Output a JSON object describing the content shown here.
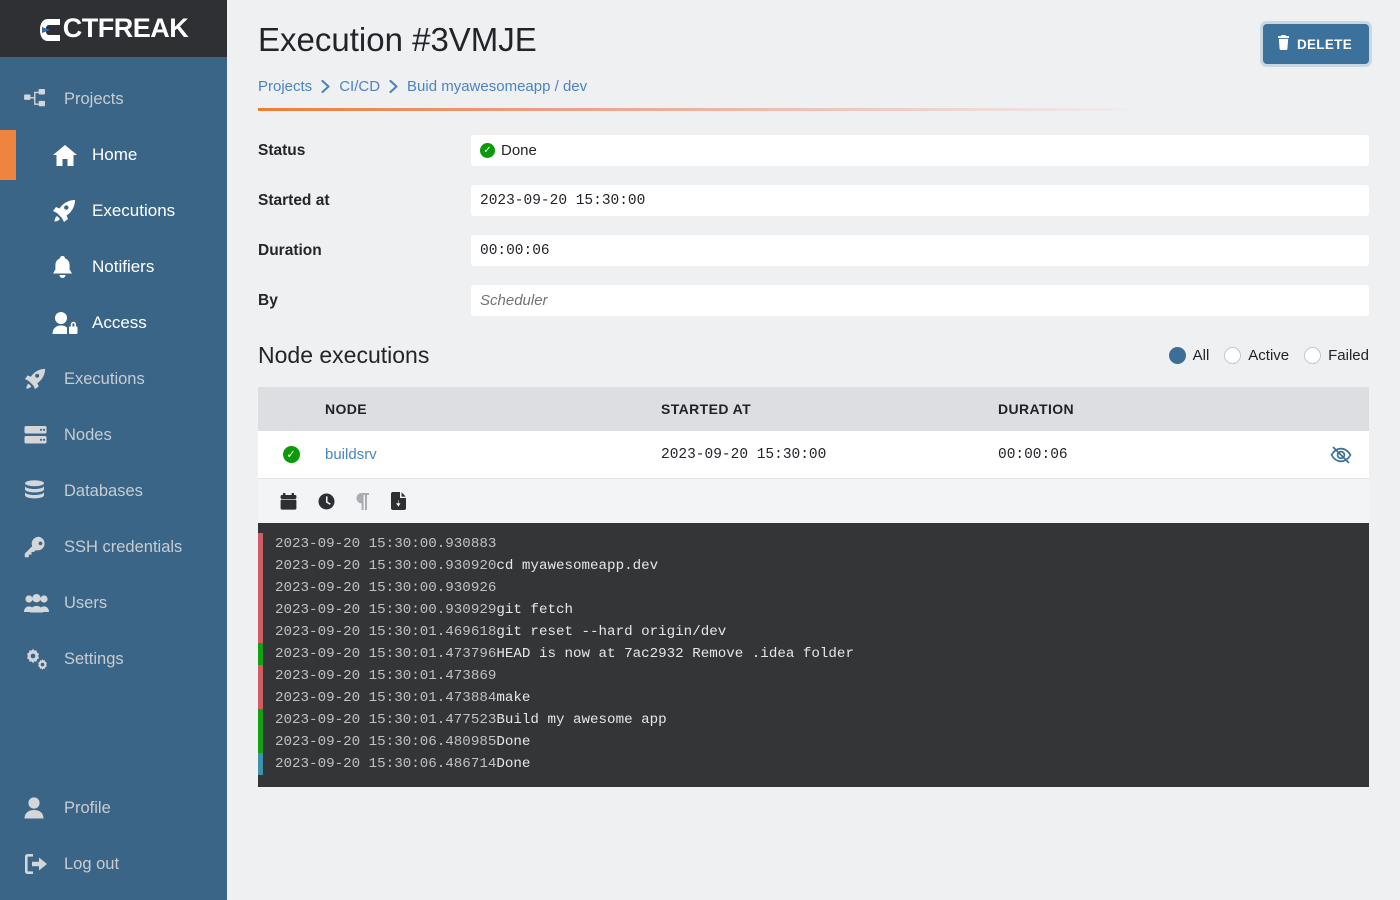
{
  "brand": {
    "logo_text": "CTFREAK"
  },
  "sidebar": {
    "groups": [
      {
        "label": "Projects",
        "icon": "sitemap-icon",
        "active": false,
        "sub": false
      },
      {
        "label": "Home",
        "icon": "home-icon",
        "active": true,
        "sub": true
      },
      {
        "label": "Executions",
        "icon": "rocket-icon",
        "active": false,
        "sub": true
      },
      {
        "label": "Notifiers",
        "icon": "bell-icon",
        "active": false,
        "sub": true
      },
      {
        "label": "Access",
        "icon": "user-lock-icon",
        "active": false,
        "sub": true
      },
      {
        "label": "Executions",
        "icon": "rocket-icon",
        "active": false,
        "sub": false
      },
      {
        "label": "Nodes",
        "icon": "server-icon",
        "active": false,
        "sub": false
      },
      {
        "label": "Databases",
        "icon": "database-icon",
        "active": false,
        "sub": false
      },
      {
        "label": "SSH credentials",
        "icon": "key-icon",
        "active": false,
        "sub": false
      },
      {
        "label": "Users",
        "icon": "users-icon",
        "active": false,
        "sub": false
      },
      {
        "label": "Settings",
        "icon": "gears-icon",
        "active": false,
        "sub": false
      }
    ],
    "bottom": [
      {
        "label": "Profile",
        "icon": "user-icon"
      },
      {
        "label": "Log out",
        "icon": "sign-out-icon"
      }
    ],
    "accent_color": "#ef8340",
    "background_color": "#3a6587"
  },
  "header": {
    "title": "Execution #3VMJE",
    "delete_label": "DELETE",
    "breadcrumb": [
      {
        "label": "Projects"
      },
      {
        "label": "CI/CD"
      },
      {
        "label": "Buid myawesomeapp / dev"
      }
    ]
  },
  "details": {
    "status": {
      "label": "Status",
      "value": "Done"
    },
    "started_at": {
      "label": "Started at",
      "value": "2023-09-20 15:30:00"
    },
    "duration": {
      "label": "Duration",
      "value": "00:00:06"
    },
    "by": {
      "label": "By",
      "value": "Scheduler"
    }
  },
  "node_executions": {
    "title": "Node executions",
    "filters": [
      {
        "label": "All",
        "checked": true
      },
      {
        "label": "Active",
        "checked": false
      },
      {
        "label": "Failed",
        "checked": false
      }
    ],
    "columns": [
      "",
      "NODE",
      "STARTED AT",
      "DURATION",
      ""
    ],
    "rows": [
      {
        "status": "done",
        "node": "buildsrv",
        "started_at": "2023-09-20 15:30:00",
        "duration": "00:00:06",
        "action": "hide-output-icon"
      }
    ],
    "toolbar_icons": [
      "calendar-icon",
      "clock-icon",
      "paragraph-icon",
      "file-download-icon"
    ]
  },
  "log": {
    "lines": [
      {
        "bar": "#cf5c64",
        "timestamp": "2023-09-20 15:30:00.930883",
        "message": ""
      },
      {
        "bar": "#cf5c64",
        "timestamp": "2023-09-20 15:30:00.930920",
        "message": "cd myawesomeapp.dev"
      },
      {
        "bar": "#cf5c64",
        "timestamp": "2023-09-20 15:30:00.930926",
        "message": ""
      },
      {
        "bar": "#cf5c64",
        "timestamp": "2023-09-20 15:30:00.930929",
        "message": "git fetch"
      },
      {
        "bar": "#cf5c64",
        "timestamp": "2023-09-20 15:30:01.469618",
        "message": "git reset --hard origin/dev"
      },
      {
        "bar": "#14a014",
        "timestamp": "2023-09-20 15:30:01.473796",
        "message": "HEAD is now at 7ac2932 Remove .idea folder"
      },
      {
        "bar": "#cf5c64",
        "timestamp": "2023-09-20 15:30:01.473869",
        "message": ""
      },
      {
        "bar": "#cf5c64",
        "timestamp": "2023-09-20 15:30:01.473884",
        "message": "make"
      },
      {
        "bar": "#14a014",
        "timestamp": "2023-09-20 15:30:01.477523",
        "message": "Build my awesome app"
      },
      {
        "bar": "#14a014",
        "timestamp": "2023-09-20 15:30:06.480985",
        "message": "Done"
      },
      {
        "bar": "#3d93ad",
        "timestamp": "2023-09-20 15:30:06.486714",
        "message": "Done"
      }
    ]
  }
}
